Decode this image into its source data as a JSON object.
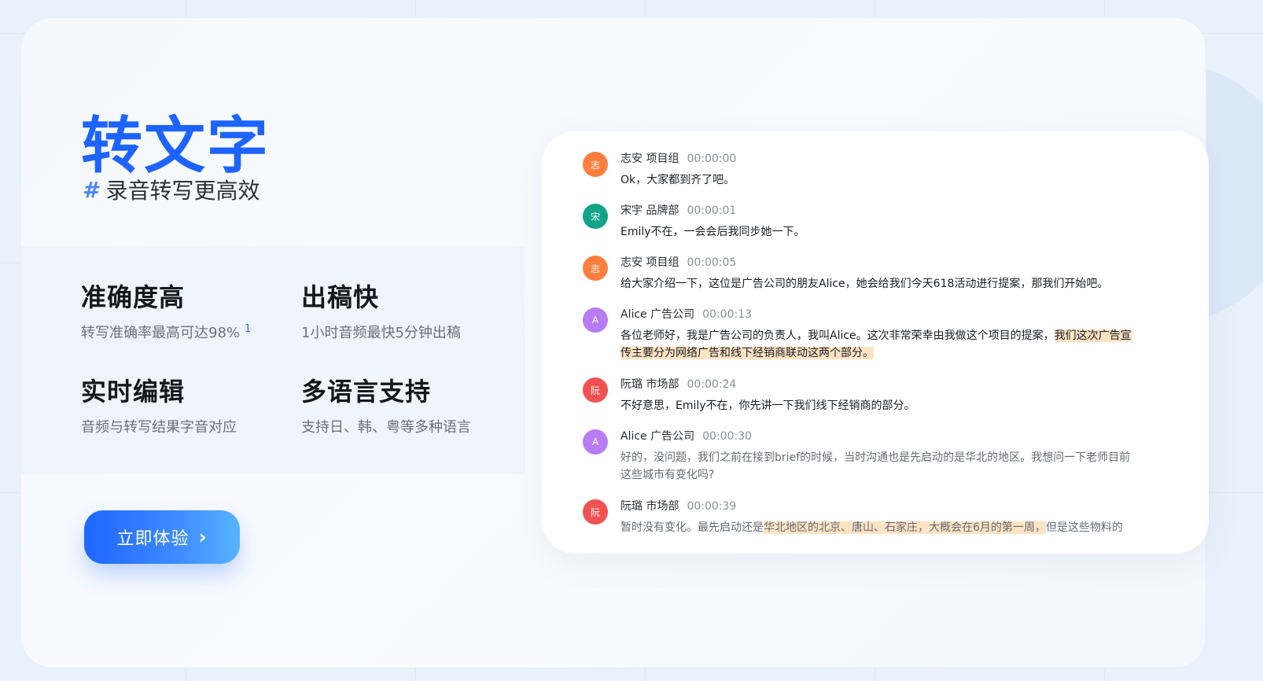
{
  "hero": {
    "title": "转文字",
    "hash": "#",
    "subtitle": "录音转写更高效"
  },
  "features": [
    {
      "title": "准确度高",
      "desc": "转写准确率最高可达98%",
      "sup": "1"
    },
    {
      "title": "出稿快",
      "desc": "1小时音频最快5分钟出稿"
    },
    {
      "title": "实时编辑",
      "desc": "音频与转写结果字音对应"
    },
    {
      "title": "多语言支持",
      "desc": "支持日、韩、粤等多种语言"
    }
  ],
  "cta": {
    "label": "立即体验",
    "chevron": "›"
  },
  "colors": {
    "brand_blue": "#1d63ff",
    "avatar_orange": "#fb7e3f",
    "avatar_teal": "#12a488",
    "avatar_purple": "#b77cf2",
    "avatar_red": "#f05151",
    "highlight": "#fde3c4"
  },
  "transcript": [
    {
      "avatar": "志",
      "speaker": "志安 项目组",
      "time": "00:00:00",
      "text": "Ok，大家都到齐了吧。"
    },
    {
      "avatar": "宋",
      "speaker": "宋宇 品牌部",
      "time": "00:00:01",
      "text": "Emily不在，一会会后我同步她一下。"
    },
    {
      "avatar": "志",
      "speaker": "志安 项目组",
      "time": "00:00:05",
      "text": "给大家介绍一下，这位是广告公司的朋友Alice，她会给我们今天618活动进行提案，那我们开始吧。"
    },
    {
      "avatar": "A",
      "speaker": "Alice 广告公司",
      "time": "00:00:13",
      "text_pre": "各位老师好，我是广告公司的负责人，我叫Alice。这次非常荣幸由我做这个项目的提案，",
      "text_hl": "我们这次广告宣传主要分为网络广告和线下经销商联动这两个部分。"
    },
    {
      "avatar": "阮",
      "speaker": "阮璐 市场部",
      "time": "00:00:24",
      "text": "不好意思，Emily不在，你先讲一下我们线下经销商的部分。"
    },
    {
      "avatar": "A",
      "speaker": "Alice 广告公司",
      "time": "00:00:30",
      "text": "好的，没问题，我们之前在接到brief的时候，当时沟通也是先启动的是华北的地区。我想问一下老师目前这些城市有变化吗?"
    },
    {
      "avatar": "阮",
      "speaker": "阮璐 市场部",
      "time": "00:00:39",
      "text_pre": "暂时没有变化。最先启动还是",
      "text_hl": "华北地区的北京、唐山、石家庄，大概会在6月的第一周，",
      "text_post": "但是这些物料的"
    }
  ]
}
